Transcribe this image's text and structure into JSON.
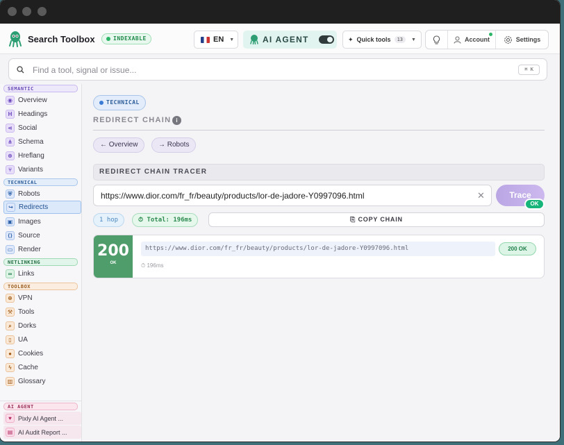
{
  "app": {
    "brand": "Search Toolbox",
    "index_badge": "INDEXABLE",
    "language": "EN",
    "ai_agent_label": "AI AGENT",
    "quick_tools_label": "Quick tools",
    "quick_tools_count": "13",
    "account_label": "Account",
    "settings_label": "Settings"
  },
  "search": {
    "placeholder": "Find a tool, signal or issue...",
    "shortcut": "⌘ K"
  },
  "sidebar": {
    "sections": {
      "semantic": "SEMANTIC",
      "technical": "TECHNICAL",
      "netlinking": "NETLINKING",
      "toolbox": "TOOLBOX",
      "ai_agent": "AI AGENT"
    },
    "items": {
      "overview": "Overview",
      "headings": "Headings",
      "social": "Social",
      "schema": "Schema",
      "hreflang": "Hreflang",
      "variants": "Variants",
      "robots": "Robots",
      "redirects": "Redirects",
      "images": "Images",
      "source": "Source",
      "render": "Render",
      "links": "Links",
      "vpn": "VPN",
      "tools": "Tools",
      "dorks": "Dorks",
      "ua": "UA",
      "cookies": "Cookies",
      "cache": "Cache",
      "glossary": "Glossary",
      "pixly": "Pixly AI Agent ...",
      "audit": "AI Audit Report ..."
    }
  },
  "main": {
    "category_chip": "TECHNICAL",
    "page_title": "REDIRECT CHAIN",
    "nav_prev": "← Overview",
    "nav_next": "→ Robots",
    "panel_title": "REDIRECT CHAIN TRACER",
    "url_value": "https://www.dior.com/fr_fr/beauty/products/lor-de-jadore-Y0997096.html",
    "trace_label": "Trace",
    "trace_status": "OK",
    "hops": "1 hop",
    "total": "Total: 196ms",
    "copy_label": "COPY CHAIN",
    "result": {
      "code": "200",
      "code_text": "OK",
      "url": "https://www.dior.com/fr_fr/beauty/products/lor-de-jadore-Y0997096.html",
      "badge": "200 OK",
      "time": "196ms"
    }
  },
  "colors": {
    "accent_green": "#4f9d6b",
    "trace_purple": "#b9a6e4",
    "ok_green": "#18b57a"
  }
}
